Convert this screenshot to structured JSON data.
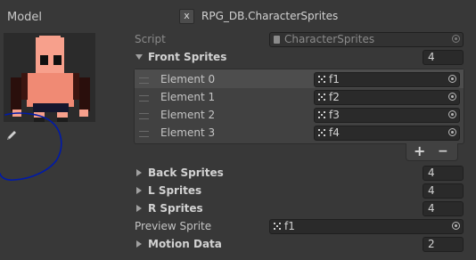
{
  "header": {
    "model_label": "Model",
    "close_label": "x",
    "title": "RPG_DB.CharacterSprites"
  },
  "script_row": {
    "label": "Script",
    "value": "CharacterSprites"
  },
  "front_sprites": {
    "label": "Front Sprites",
    "size": "4",
    "elements": [
      {
        "label": "Element 0",
        "value": "f1"
      },
      {
        "label": "Element 1",
        "value": "f2"
      },
      {
        "label": "Element 2",
        "value": "f3"
      },
      {
        "label": "Element 3",
        "value": "f4"
      }
    ],
    "add_label": "+",
    "remove_label": "−"
  },
  "back_sprites": {
    "label": "Back Sprites",
    "size": "4"
  },
  "l_sprites": {
    "label": "L Sprites",
    "size": "4"
  },
  "r_sprites": {
    "label": "R Sprites",
    "size": "4"
  },
  "preview_sprite": {
    "label": "Preview Sprite",
    "value": "f1"
  },
  "motion_data": {
    "label": "Motion Data",
    "size": "2"
  },
  "icons": [
    "close-icon",
    "script-icon",
    "sprite-icon",
    "object-picker-icon",
    "pencil-icon",
    "foldout-arrow-icon",
    "drag-handle-icon"
  ],
  "colors": {
    "background": "#383838",
    "field": "#2a2a2a",
    "list_background": "#414141",
    "ink_circle": "#001aa8"
  }
}
